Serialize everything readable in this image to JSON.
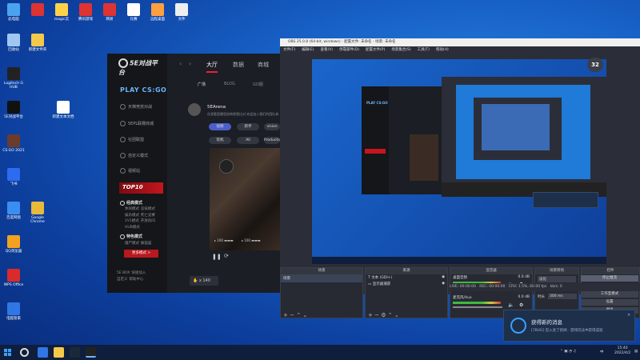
{
  "desktop": {
    "icons": [
      {
        "label": "此电脑",
        "color": "#4aa3f0"
      },
      {
        "label": "",
        "color": "#d33"
      },
      {
        "label": "magic云",
        "color": "#ffd24a"
      },
      {
        "label": "腾讯游戏",
        "color": "#d33"
      },
      {
        "label": "网易",
        "color": "#d33"
      },
      {
        "label": "比赛",
        "color": "#fff"
      },
      {
        "label": "远程桌面",
        "color": "#ffa040"
      },
      {
        "label": "文件",
        "color": "#eee"
      },
      {
        "label": "回收站",
        "color": "#9fc7f2"
      },
      {
        "label": "新建文件夹",
        "color": "#f4c84a"
      },
      {
        "label": "Logitech G HUB",
        "color": "#222"
      },
      {
        "label": "5E对战平台",
        "color": "#111"
      },
      {
        "label": "新建文本文档",
        "color": "#fff"
      },
      {
        "label": "CS:GO 2021",
        "color": "#6b3b2b"
      },
      {
        "label": "飞书",
        "color": "#2d6cf0"
      },
      {
        "label": "百度网盘",
        "color": "#3a8ef2"
      },
      {
        "label": "Google Chrome",
        "color": "#e8b93a"
      },
      {
        "label": "QQ浏览器",
        "color": "#f3a21f"
      },
      {
        "label": "WPS Office",
        "color": "#d92b2b"
      },
      {
        "label": "电脑管家",
        "color": "#2f77e6"
      }
    ]
  },
  "platform": {
    "logo": "5E对战平台",
    "nav": {
      "back": "‹",
      "forward": "›",
      "tab1": "大厅",
      "tab2": "数据",
      "tab3": "商城"
    },
    "subtabs": [
      "广场",
      "BLOG",
      "GO圈"
    ],
    "game": "PLAY CS:GO",
    "side_items": [
      "天梯竞技对战",
      "5EPL联赛商城",
      "社团联盟",
      "自定义模式",
      "视频站"
    ],
    "top10": "TOP10",
    "mode1": {
      "title": "经典模式",
      "subs": [
        "休闲模式",
        "竞技模式",
        "娱乐模式",
        "死亡竞赛",
        "1V1模式",
        "开放房间",
        "HUB模式"
      ]
    },
    "mode2": {
      "title": "特色模式",
      "subs": [
        "僵尸模式",
        "躲猫猫"
      ]
    },
    "red_button": "更多模式 >",
    "footer": [
      "5E BOX",
      "快速加入",
      "自定义",
      "帮助中心"
    ],
    "post": {
      "user": "5EArena",
      "text": "在观看直播里经典视频比对 欢迎加入我们的团队参与观看群",
      "tags": [
        "视频",
        "新手",
        "vision"
      ],
      "tags2": [
        "玩机",
        "All",
        "Production"
      ],
      "caption_a": "▸ 100 ▬▬▬",
      "caption_b": "▸ 100 ▬▬▬",
      "likes": "x 140"
    }
  },
  "obs": {
    "title": "OBS 25.0.8 (64-bit, windows) - 配置文件: 未命名 - 场景: 未命名",
    "menu": [
      "文件(F)",
      "编辑(E)",
      "查看(V)",
      "停靠部件(D)",
      "配置文件(P)",
      "场景集合(S)",
      "工具(T)",
      "帮助(H)"
    ],
    "fps_badge": "32",
    "docks": {
      "scenes": {
        "head": "场景",
        "items": [
          "场景"
        ]
      },
      "sources": {
        "head": "来源",
        "items": [
          "文本 (GDI+)",
          "显示器捕获"
        ]
      },
      "mixer": {
        "head": "混音器",
        "track1": "桌面音频",
        "track1_db": "0.0 dB",
        "track2": "麦克风/Aux",
        "track2_db": "0.0 dB"
      },
      "transitions": {
        "head": "场景转场",
        "type": "淡化",
        "duration_label": "时长",
        "duration": "300 ms"
      },
      "controls": {
        "head": "控件",
        "buttons": [
          "停止推流",
          "开始录制",
          "工作室模式",
          "设置",
          "退出"
        ]
      }
    },
    "status": {
      "live": "LIVE: 00:00:00",
      "rec": "REC: 00:00:00",
      "cpu": "CPU: 1.5%, 60.00 fps",
      "kb": "kb/s: 0"
    }
  },
  "notification": {
    "title": "获得新的消息",
    "body": "[7BUG] 您入驻了新闻 · 游戏玩法中获得成就",
    "close": "✕"
  },
  "taskbar": {
    "time": "15:40",
    "date": "2022/4/2",
    "lang": "中"
  }
}
